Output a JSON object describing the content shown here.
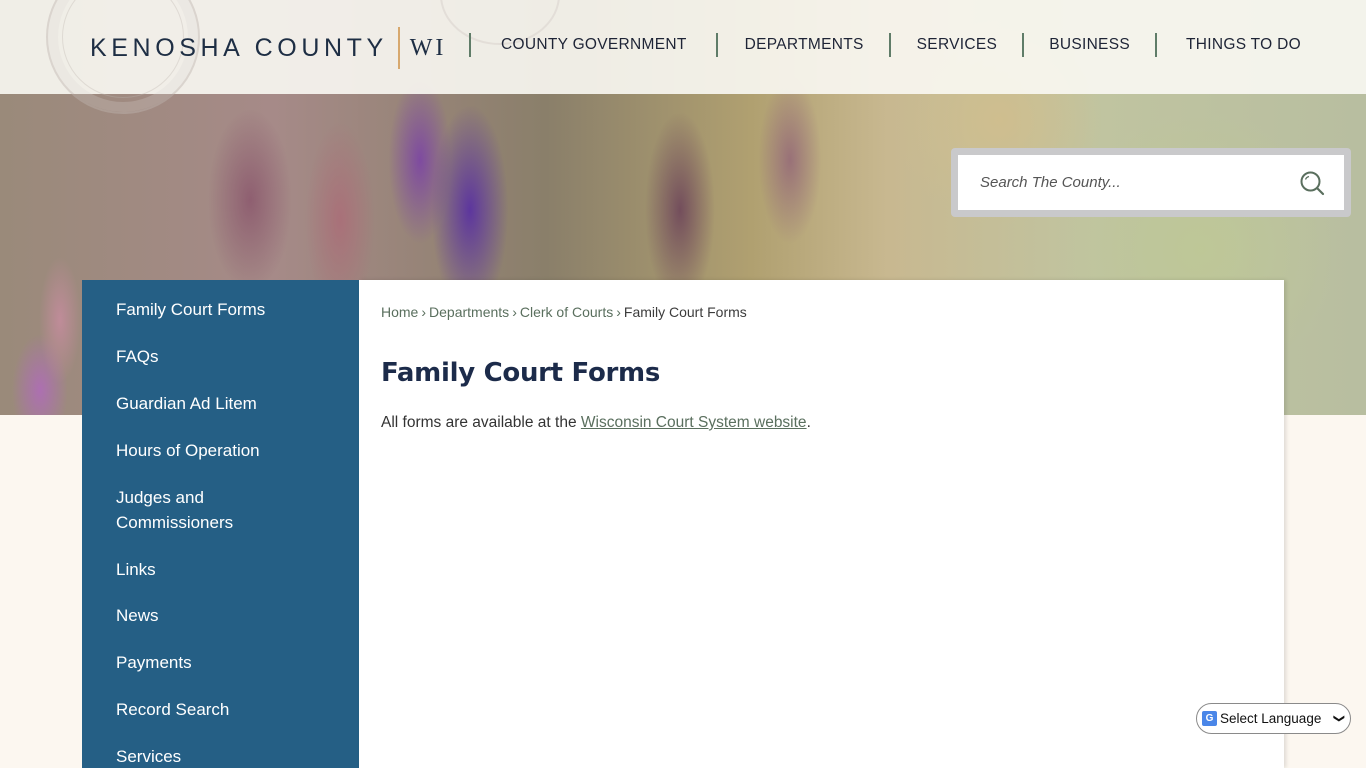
{
  "header": {
    "logo_main": "KENOSHA COUNTY",
    "logo_state": "WI",
    "nav": [
      {
        "label": "County Government"
      },
      {
        "label": "Departments"
      },
      {
        "label": "Services"
      },
      {
        "label": "Business"
      },
      {
        "label": "Things To Do"
      }
    ]
  },
  "search": {
    "placeholder": "Search The County...",
    "icon": "search-icon"
  },
  "sidebar": {
    "items": [
      {
        "label": "Family Court Forms"
      },
      {
        "label": "FAQs"
      },
      {
        "label": "Guardian Ad Litem"
      },
      {
        "label": "Hours of Operation"
      },
      {
        "label": "Judges and Commissioners"
      },
      {
        "label": "Links"
      },
      {
        "label": "News"
      },
      {
        "label": "Payments"
      },
      {
        "label": "Record Search"
      },
      {
        "label": "Services"
      }
    ]
  },
  "breadcrumb": {
    "items": [
      {
        "label": "Home"
      },
      {
        "label": "Departments"
      },
      {
        "label": "Clerk of Courts"
      }
    ],
    "separator": "›",
    "current": "Family Court Forms"
  },
  "main": {
    "title": "Family Court Forms",
    "text_before": "All forms are available at the ",
    "link_text": "Wisconsin Court System website",
    "text_after": "."
  },
  "language": {
    "selected": "Select Language",
    "icon": "google-translate-icon"
  },
  "colors": {
    "sidebar_bg": "#255f85",
    "title": "#1c2b4a",
    "link": "#5a6f5e",
    "nav_divider": "#5f7c68",
    "logo_divider": "#d7a86e",
    "page_bg": "#fcf7f0"
  }
}
